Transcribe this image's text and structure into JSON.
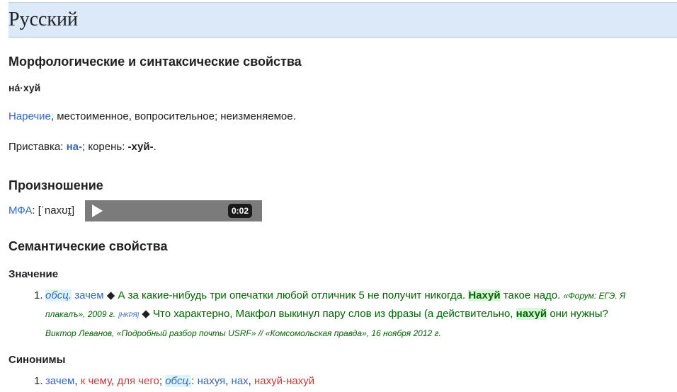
{
  "language": "Русский",
  "morph": {
    "heading": "Морфологические и синтаксические свойства",
    "word": "на́·хуй",
    "pos_link": "Наречие",
    "pos_desc": ", местоименное, вопросительное; неизменяемое.",
    "prefix_label": "Приставка: ",
    "prefix": "на-",
    "root_label": "; корень: ",
    "root": "-хуй-",
    "end": "."
  },
  "pron": {
    "heading": "Произношение",
    "ipa_label": "МФА",
    "ipa_colon": ": ",
    "ipa": "[ˈnaxʊɪ̯]",
    "audio_time": "0:02"
  },
  "sem": {
    "heading": "Семантические свойства",
    "meaning_heading": "Значение",
    "item_num": "1.",
    "abbr": "обсц.",
    "gloss": "зачем",
    "diamond": "◆",
    "ex1_a": "А за какие-нибудь три опечатки любой отличник 5 не получит никогда.",
    "ex1_hl": "Нахуй",
    "ex1_b": "такое надо.",
    "src1_a": "«Форум: ЕГЭ. Я",
    "src1_b": "плакалъ», 2009 г.",
    "nkry": "[НКРЯ]",
    "ex2_a": "Что характерно, Макфол выкинул пару слов из фразы (а действительно,",
    "ex2_hl": "нахуй",
    "ex2_b": "они нужны?",
    "src2": "Виктор Леванов, «Подробный разбор почты USRF» // «Комсомольская правда», 16 ноября 2012 г."
  },
  "syn": {
    "heading": "Синонимы",
    "item_num": "1.",
    "s1": "зачем",
    "s2": "к чему",
    "s3": "для чего",
    "abbr": "обсц.",
    "s4": "нахуя",
    "s5": "нах",
    "s6": "нахуй-нахуй"
  }
}
